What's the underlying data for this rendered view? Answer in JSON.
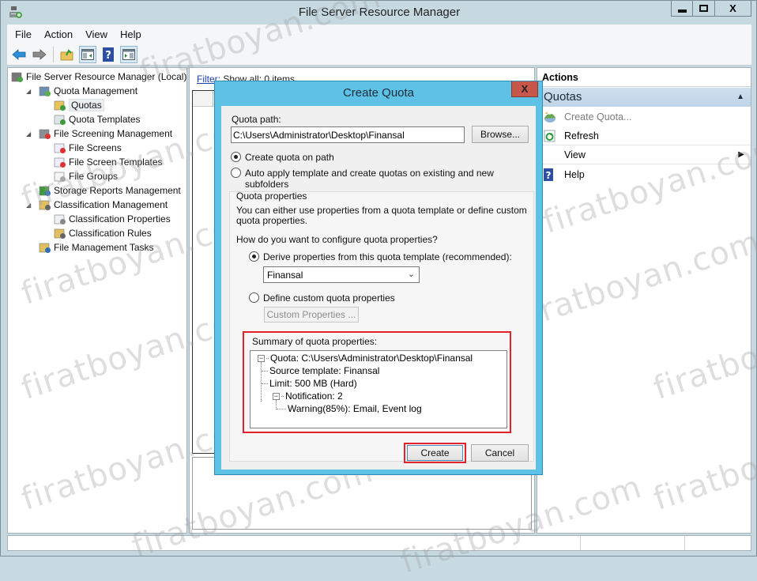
{
  "window": {
    "title": "File Server Resource Manager",
    "controls": {
      "minimize": "▁",
      "maximize": "☐",
      "close": "X"
    }
  },
  "menubar": {
    "items": [
      "File",
      "Action",
      "View",
      "Help"
    ]
  },
  "toolbar": {
    "buttons": [
      "back-arrow-icon",
      "forward-arrow-icon",
      "up-folder-icon",
      "show-hide-tree-icon",
      "help-icon",
      "show-hide-action-pane-icon"
    ]
  },
  "tree": {
    "items": [
      {
        "label": "File Server Resource Manager (Local)",
        "level": 0,
        "expander": "",
        "icon": "server-icon"
      },
      {
        "label": "Quota Management",
        "level": 1,
        "expander": "◢",
        "icon": "quota-management-icon"
      },
      {
        "label": "Quotas",
        "level": 2,
        "expander": "",
        "icon": "quotas-folder-icon",
        "selected": true
      },
      {
        "label": "Quota Templates",
        "level": 2,
        "expander": "",
        "icon": "quota-template-icon"
      },
      {
        "label": "File Screening Management",
        "level": 1,
        "expander": "◢",
        "icon": "file-screening-icon"
      },
      {
        "label": "File Screens",
        "level": 2,
        "expander": "",
        "icon": "file-screens-icon"
      },
      {
        "label": "File Screen Templates",
        "level": 2,
        "expander": "",
        "icon": "file-screen-template-icon"
      },
      {
        "label": "File Groups",
        "level": 2,
        "expander": "",
        "icon": "file-groups-icon"
      },
      {
        "label": "Storage Reports Management",
        "level": 1,
        "expander": "",
        "icon": "storage-reports-icon"
      },
      {
        "label": "Classification Management",
        "level": 1,
        "expander": "◢",
        "icon": "classification-icon"
      },
      {
        "label": "Classification Properties",
        "level": 2,
        "expander": "",
        "icon": "classification-properties-icon"
      },
      {
        "label": "Classification Rules",
        "level": 2,
        "expander": "",
        "icon": "classification-rules-icon"
      },
      {
        "label": "File Management Tasks",
        "level": 1,
        "expander": "",
        "icon": "file-management-tasks-icon"
      }
    ]
  },
  "center": {
    "filter_link": "Filter:",
    "filter_text": " Show all: 0 items"
  },
  "actions": {
    "title": "Actions",
    "section": "Quotas",
    "section_caret": "▲",
    "items": [
      {
        "label": "Create Quota...",
        "icon": "create-quota-icon",
        "disabled": true
      },
      {
        "label": "Refresh",
        "icon": "refresh-icon",
        "disabled": false
      },
      {
        "label": "View",
        "icon": "",
        "submenu": "▶",
        "disabled": false
      },
      {
        "label": "Help",
        "icon": "help-icon",
        "disabled": false
      }
    ]
  },
  "dialog": {
    "title": "Create Quota",
    "close": "X",
    "quota_path_label": "Quota path:",
    "quota_path_value": "C:\\Users\\Administrator\\Desktop\\Finansal",
    "browse_label": "Browse...",
    "radio_create_on_path": {
      "label": "Create quota on path",
      "checked": true
    },
    "radio_auto_apply": {
      "label": "Auto apply template and create quotas on existing and new subfolders",
      "checked": false
    },
    "group_title": "Quota properties",
    "group_desc_line1": "You can either use properties from a quota template or define custom",
    "group_desc_line2": "quota properties.",
    "config_question": "How do you want to configure quota properties?",
    "radio_derive": {
      "label": "Derive properties from this quota template (recommended):",
      "checked": true
    },
    "template_selected": "Finansal",
    "radio_custom": {
      "label": "Define custom quota properties",
      "checked": false
    },
    "custom_props_button": "Custom Properties ...",
    "summary_label": "Summary of quota properties:",
    "summary_tree": {
      "root": "Quota: C:\\Users\\Administrator\\Desktop\\Finansal",
      "source_template": "Source template: Finansal",
      "limit": "Limit: 500 MB (Hard)",
      "notification": "Notification: 2",
      "warning": "Warning(85%): Email, Event log"
    },
    "create_button": "Create",
    "cancel_button": "Cancel"
  },
  "watermark": "firatboyan.com",
  "colors": {
    "dialog_frame": "#5ec2e6",
    "highlight_red": "#e1222c",
    "close_red": "#c6574a",
    "window_frame": "#c6d9e1",
    "actions_header": "#c7dbec"
  }
}
